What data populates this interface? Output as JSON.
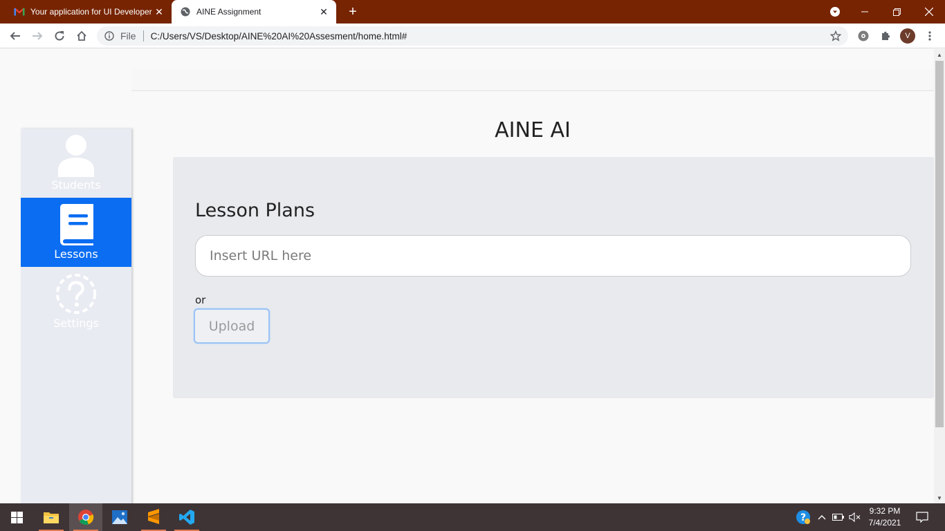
{
  "browser": {
    "tabs": [
      {
        "title": "Your application for UI Developer",
        "active": false,
        "favicon": "gmail-icon"
      },
      {
        "title": "AINE Assignment",
        "active": true,
        "favicon": "globe-icon"
      }
    ],
    "address": {
      "scheme_label": "File",
      "url": "C:/Users/VS/Desktop/AINE%20AI%20Assesment/home.html#"
    },
    "profile_initial": "V"
  },
  "sidebar": {
    "items": [
      {
        "label": "Students",
        "icon": "person-icon",
        "active": false
      },
      {
        "label": "Lessons",
        "icon": "book-icon",
        "active": true
      },
      {
        "label": "Settings",
        "icon": "question-circle-icon",
        "active": false
      }
    ]
  },
  "main": {
    "title": "AINE AI",
    "card": {
      "heading": "Lesson Plans",
      "url_placeholder": "Insert URL here",
      "url_value": "",
      "or_text": "or",
      "upload_label": "Upload"
    }
  },
  "taskbar": {
    "apps": [
      "windows-start-icon",
      "file-explorer-icon",
      "chrome-icon",
      "photos-icon",
      "sublime-text-icon",
      "vscode-icon"
    ],
    "time": "9:32 PM",
    "date": "7/4/2021"
  },
  "colors": {
    "tabstrip": "#772403",
    "active_nav": "#0a6df2",
    "sidebar_bg": "#e9ebf2",
    "card_bg": "#e8eaed"
  }
}
